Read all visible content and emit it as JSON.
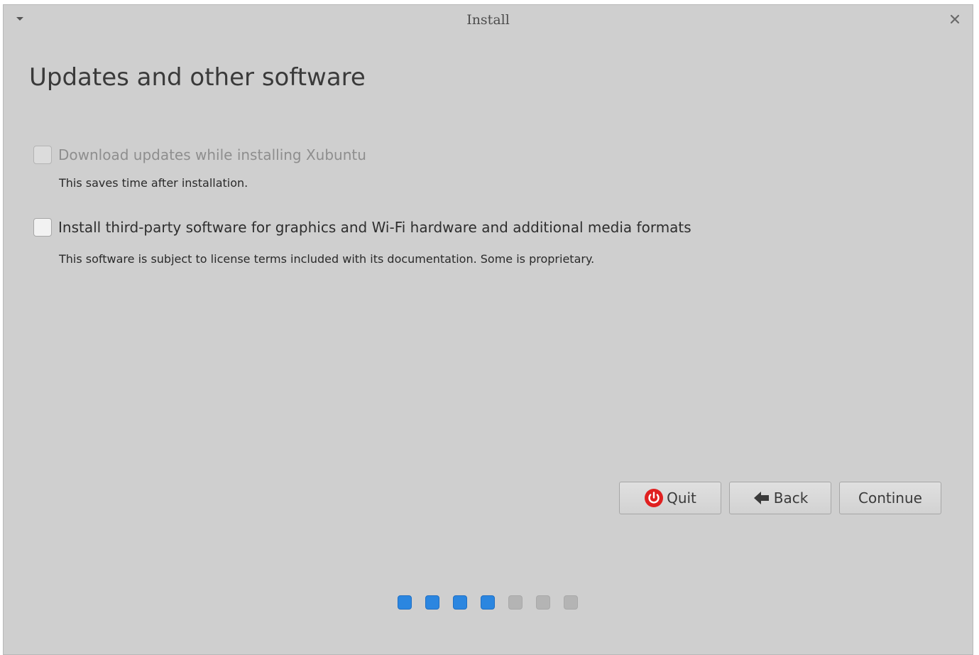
{
  "window": {
    "title": "Install",
    "close_icon": "close-icon",
    "menu_icon": "menu-arrow-icon"
  },
  "page": {
    "heading": "Updates and other software"
  },
  "options": [
    {
      "label": "Download updates while installing Xubuntu",
      "description": "This saves time after installation.",
      "checked": false,
      "enabled": false
    },
    {
      "label": "Install third-party software for graphics and Wi-Fi hardware and additional media formats",
      "description": "This software is subject to license terms included with its documentation. Some is proprietary.",
      "checked": false,
      "enabled": true
    }
  ],
  "buttons": {
    "quit": {
      "label": "Quit",
      "icon": "power-icon",
      "icon_color": "#e02020"
    },
    "back": {
      "label": "Back",
      "icon": "arrow-left-icon"
    },
    "continue": {
      "label": "Continue"
    }
  },
  "progress": {
    "total_steps": 7,
    "completed_steps": 4,
    "active_color": "#2b86e0",
    "inactive_color": "#b4b4b4"
  }
}
